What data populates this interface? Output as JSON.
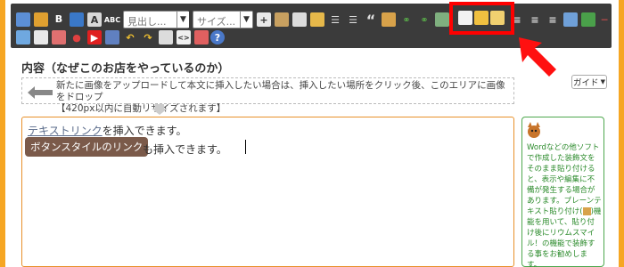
{
  "toolbar": {
    "heading_select": "見出し...",
    "size_select": "サイズ...",
    "icons": [
      "insert-image-icon",
      "upload-icon",
      "bold-icon",
      "pen-icon",
      "text-color-icon",
      "spellcheck-icon",
      "add-icon",
      "paste-icon",
      "comment-icon",
      "folder-icon",
      "bulleted-list-icon",
      "numbered-list-icon",
      "quote-icon",
      "copy-icon",
      "link-icon",
      "unlink-icon",
      "paste-text-icon",
      "paste-word-icon",
      "paste-plain-icon",
      "align-left-icon",
      "align-center-icon",
      "align-right-icon",
      "table-icon",
      "horizontal-rule-icon",
      "image-gallery-icon",
      "video-icon",
      "map-pin-icon",
      "youtube-icon",
      "embed-icon",
      "undo-icon",
      "redo-icon",
      "preview-icon",
      "source-icon",
      "clipboard-icon",
      "help-icon"
    ],
    "help_glyph": "?",
    "bold_glyph": "B",
    "spell_glyph": "ABC"
  },
  "section": {
    "title": "内容（なぜこのお店をやっているのか）"
  },
  "upload": {
    "line1": "新たに画像をアップロードして本文に挿入したい場合は、挿入したい場所をクリック後、このエリアに画像をドロップ",
    "line2": "【420px以内に自動リサイズされます】"
  },
  "guide_button": {
    "label": "ガイド"
  },
  "editor": {
    "text_link": "テキストリンク",
    "line1_suffix": "を挿入できます。",
    "button_link": "ボタンスタイルのリンク",
    "line2_suffix": "も挿入できます。"
  },
  "tip": {
    "line1": "Wordなどの他ソフトで作成した装飾文をそのまま貼り付けると、表示や編集に不備が発生する場合があります。",
    "line2": "プレーンテキスト貼り付け(",
    "line2_icon_after": ")機能を用いて、貼り付け後にリウムスマイル！の機能で装飾する事をお勧めします。"
  },
  "colors": {
    "page_background": "#f6a623",
    "toolbar_background": "#3b3b3b",
    "highlight": "#ff0000",
    "editor_border": "#e8902a",
    "tip_text": "#2a8a2a",
    "button_link_bg": "#7b5a4a"
  }
}
